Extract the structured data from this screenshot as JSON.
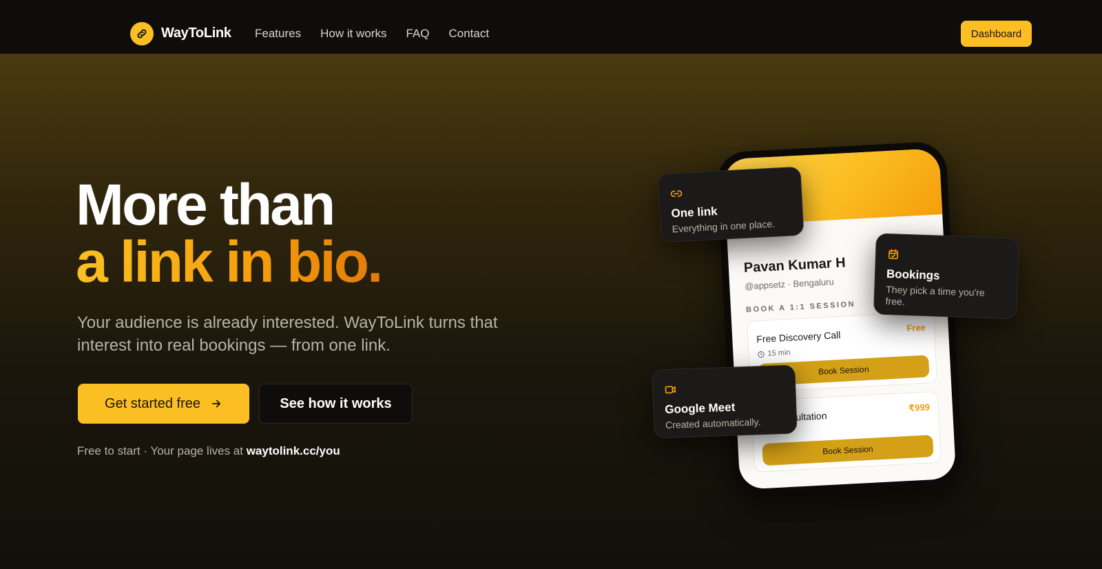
{
  "nav": {
    "brand": "WayToLink",
    "links": [
      "Features",
      "How it works",
      "FAQ",
      "Contact"
    ],
    "dashboard_label": "Dashboard"
  },
  "hero": {
    "headline_line1": "More than",
    "headline_line2": "a link in bio.",
    "subtext": "Your audience is already interested. WayToLink turns that interest into real bookings — from one link.",
    "cta_primary": "Get started free",
    "cta_secondary": "See how it works",
    "note_prefix": "Free to start · Your page lives at ",
    "note_url": "waytolink.cc/you"
  },
  "phone": {
    "name": "Pavan Kumar H",
    "handle": "@appsetz · Bengaluru",
    "section_label": "BOOK A 1:1 SESSION",
    "services": [
      {
        "title": "Free Discovery Call",
        "price": "Free",
        "duration": "15 min",
        "button": "Book Session"
      },
      {
        "title": "sultation",
        "price": "₹999",
        "button": "Book Session"
      }
    ]
  },
  "cards": {
    "one_link": {
      "title": "One link",
      "desc": "Everything in one place."
    },
    "bookings": {
      "title": "Bookings",
      "desc": "They pick a time you're free."
    },
    "google_meet": {
      "title": "Google Meet",
      "desc": "Created automatically."
    }
  },
  "colors": {
    "accent": "#fbbf24",
    "accent_dark": "#f59e0b",
    "background": "#110f0a"
  },
  "icons": {
    "brand": "link-icon",
    "cta_arrow": "arrow-right-icon",
    "card_one_link": "link-icon",
    "card_bookings": "calendar-check-icon",
    "card_meet": "video-camera-icon",
    "duration": "clock-icon"
  }
}
